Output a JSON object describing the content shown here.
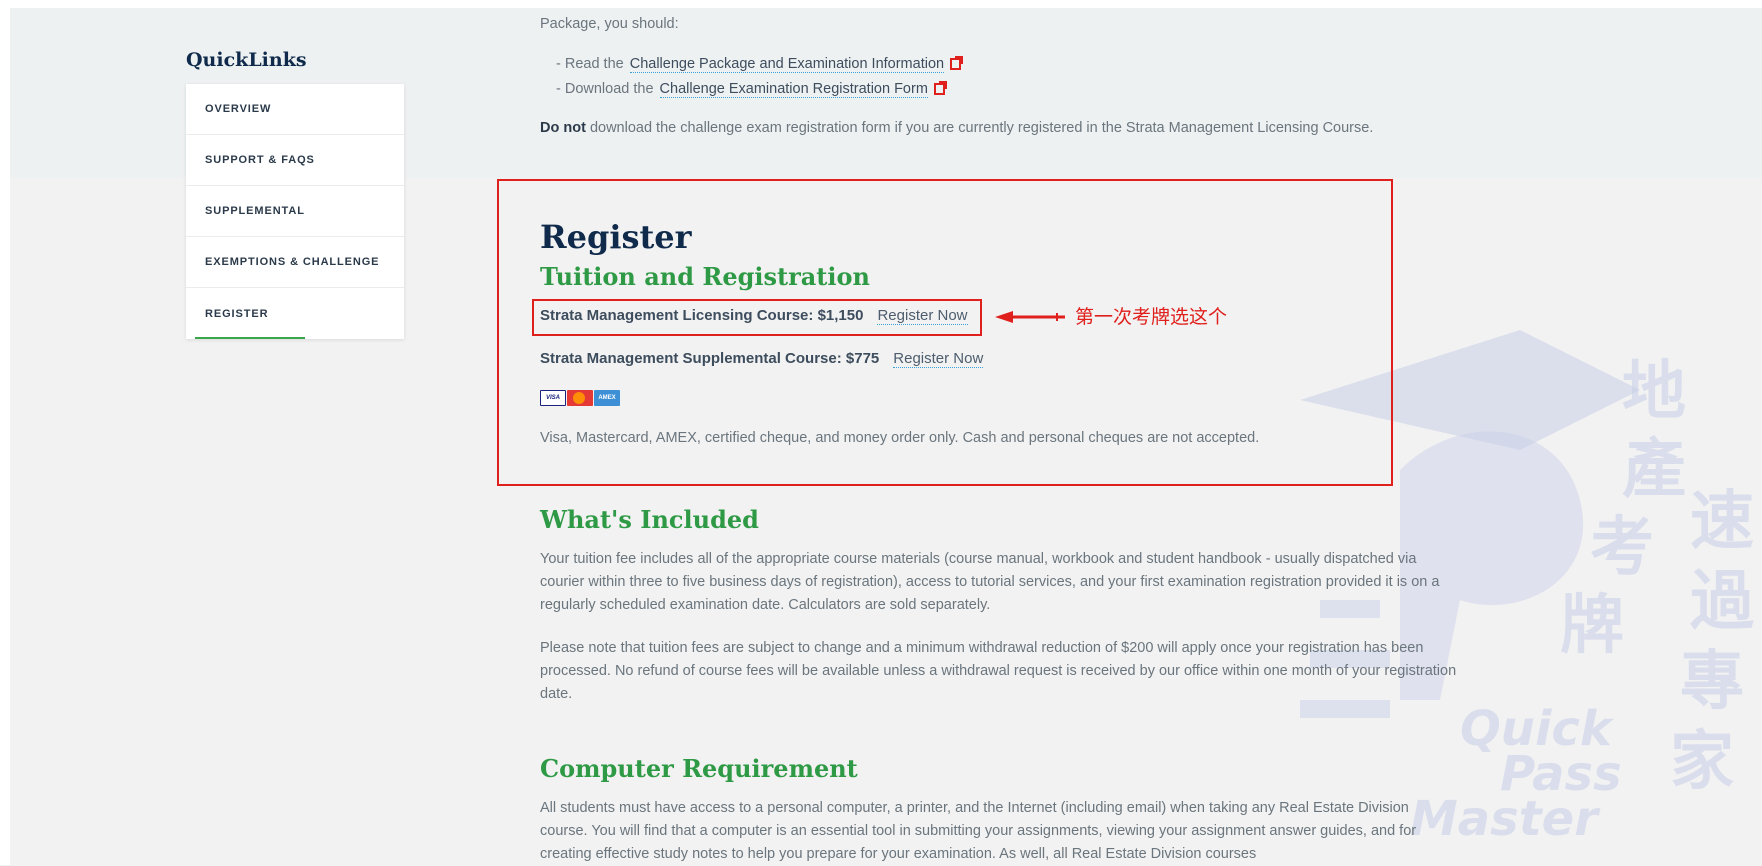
{
  "quicklinks": {
    "title": "QuickLinks",
    "items": [
      {
        "label": "OVERVIEW"
      },
      {
        "label": "SUPPORT & FAQS"
      },
      {
        "label": "SUPPLEMENTAL"
      },
      {
        "label": "EXEMPTIONS & CHALLENGE"
      },
      {
        "label": "REGISTER"
      }
    ],
    "active": "REGISTER"
  },
  "intro": {
    "package_line": "Package, you should:",
    "list": [
      {
        "prefix": "- Read the",
        "link": "Challenge Package and Examination Information",
        "icon": "pdf-icon"
      },
      {
        "prefix": "- Download the",
        "link": "Challenge Examination Registration Form",
        "icon": "pdf-icon"
      }
    ],
    "donot_bold": "Do not",
    "donot_rest": "download the challenge exam registration form if you are currently registered in the Strata Management Licensing Course."
  },
  "register": {
    "title": "Register",
    "subtitle": "Tuition and Registration",
    "courses": [
      {
        "name": "Strata Management Licensing Course:",
        "price": "$1,150",
        "link": "Register Now"
      },
      {
        "name": "Strata Management Supplemental Course:",
        "price": "$775",
        "link": "Register Now"
      }
    ],
    "cards": [
      "VISA",
      "MC",
      "AMEX"
    ],
    "payment_note": "Visa, Mastercard, AMEX, certified cheque, and money order only. Cash and personal cheques are not accepted."
  },
  "annotation": {
    "text": "第一次考牌选这个",
    "color": "#e0201c"
  },
  "whats_included": {
    "heading": "What's Included",
    "p1": "Your tuition fee includes all of the appropriate course materials (course manual, workbook and student handbook - usually dispatched via courier within three to five business days of registration), access to tutorial services, and your first examination registration provided it is on a regularly scheduled examination date. Calculators are sold separately.",
    "p2": "Please note that tuition fees are subject to change and a minimum withdrawal reduction of $200 will apply once your registration has been processed. No refund of course fees will be available unless a withdrawal request is received by our office within one month of your registration date."
  },
  "computer": {
    "heading": "Computer Requirement",
    "p1": "All students must have access to a personal computer, a printer, and the Internet (including email) when taking any Real Estate Division course. You will find that a computer is an essential tool in submitting your assignments, viewing your assignment answer guides, and for creating effective study notes to help you prepare for your examination. As well, all Real Estate Division courses"
  },
  "watermark": {
    "chars": [
      "地",
      "產",
      "考",
      "牌",
      "速",
      "過",
      "專",
      "家"
    ],
    "english": [
      "Quick",
      "Pass",
      "Master"
    ]
  },
  "colors": {
    "navy": "#0f2a4a",
    "green": "#2f9a45",
    "annotation_red": "#e0201c"
  }
}
